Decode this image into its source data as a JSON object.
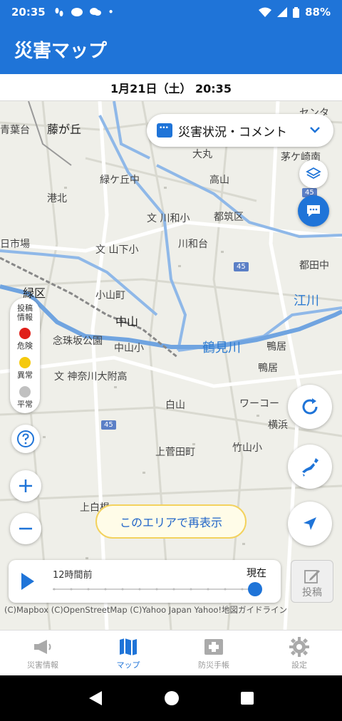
{
  "status_bar": {
    "time": "20:35",
    "battery": "88%"
  },
  "app_bar": {
    "title": "災害マップ"
  },
  "date_bar": {
    "date": "1月21日（土） 20:35"
  },
  "map": {
    "labels": {
      "sentar": "センタ",
      "aobadai": "青葉台",
      "fujigaoka": "藤が丘",
      "taimaru": "大丸",
      "chigasakiminami": "茅ケ崎南",
      "midorisaichu": "緑ケ丘中",
      "takayama": "高山",
      "kohoku": "港北",
      "kawawasho": "文 川和小",
      "tsuzuki": "都筑区",
      "hiichiba": "日市場",
      "kawawadai": "川和台",
      "yamashitasho": "文 山下小",
      "tsuzukigawa": "都田中",
      "midoriku": "緑区",
      "kobamachi": "小山町",
      "ekawa": "江川",
      "nakayama": "中山",
      "nenbutsu": "念珠坂公園",
      "nakayamasho": "中山小",
      "tsurumigawa": "鶴見川",
      "kamoi": "鴨居",
      "kamoi2": "鴨居",
      "kanagawa_daifuzoku": "文 神奈川大附高",
      "shirayama": "白山",
      "walmart": "ワーコー",
      "yokohama": "横浜",
      "kamisugeta": "上菅田町",
      "takeyama": "竹山小",
      "ueshira": "上白根",
      "route": "45",
      "route2": "45",
      "route3": "45"
    }
  },
  "comment_selector": {
    "label": "災害状況・コメント"
  },
  "legend": {
    "title_line1": "投稿",
    "title_line2": "情報",
    "items": [
      {
        "label": "危険",
        "color": "#e0201a"
      },
      {
        "label": "異常",
        "color": "#f5c90d"
      },
      {
        "label": "平常",
        "color": "#c0c0c0"
      }
    ]
  },
  "redisplay_button": {
    "label": "このエリアで再表示"
  },
  "timeline": {
    "left_label": "12時間前",
    "right_label": "現在",
    "position": 1.0
  },
  "post_button": {
    "label": "投稿"
  },
  "map_credit": {
    "text": "(C)Mapbox (C)OpenStreetMap (C)Yahoo Japan Yahoo!地図ガイドライン"
  },
  "bottom_nav": [
    {
      "label": "災害情報",
      "icon": "megaphone-icon",
      "active": false
    },
    {
      "label": "マップ",
      "icon": "map-icon",
      "active": true
    },
    {
      "label": "防災手帳",
      "icon": "first-aid-icon",
      "active": false
    },
    {
      "label": "設定",
      "icon": "gear-icon",
      "active": false
    }
  ],
  "colors": {
    "primary": "#1f74d8",
    "danger": "#e0201a",
    "warning": "#f5c90d",
    "normal": "#c0c0c0"
  }
}
